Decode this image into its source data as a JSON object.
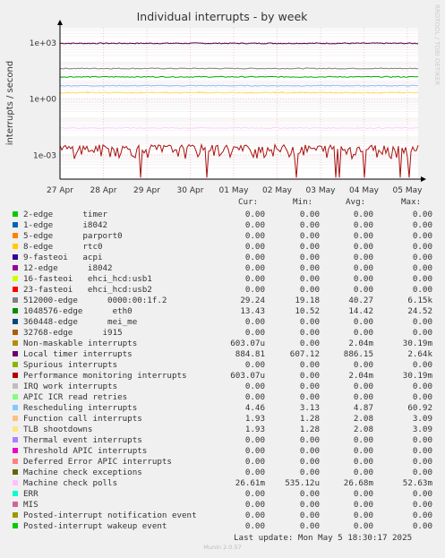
{
  "chart_data": {
    "type": "line",
    "title": "Individual interrupts - by week",
    "ylabel": "interrupts / second",
    "side_label": "RRDTOOL / TOBI OETIKER",
    "yscale": "log",
    "ylim": [
      5e-05,
      6000
    ],
    "yticks": [
      "1e+03",
      "1e+00",
      "1e-03"
    ],
    "ytick_values": [
      1000,
      1,
      0.001
    ],
    "xticks": [
      "27 Apr",
      "28 Apr",
      "29 Apr",
      "30 Apr",
      "01 May",
      "02 May",
      "03 May",
      "04 May",
      "05 May"
    ],
    "series": [
      {
        "name": "Local timer interrupts",
        "color": "#550055",
        "value": 886.15
      },
      {
        "name": "512000-edge 0000:00:1f.2",
        "color": "#7f7f7f",
        "value": 40.27
      },
      {
        "name": "1048576-edge eth0",
        "color": "#00aa00",
        "value": 14.42
      },
      {
        "name": "Rescheduling interrupts",
        "color": "#88bbff",
        "value": 4.87
      },
      {
        "name": "Function call interrupts",
        "color": "#ffcc66",
        "value": 2.08
      },
      {
        "name": "TLB shootdowns",
        "color": "#ffe680",
        "value": 2.08
      },
      {
        "name": "Machine check polls",
        "color": "#ffccff",
        "value": 0.0267
      },
      {
        "name": "Performance monitoring interrupts",
        "color": "#aa1111",
        "value": 0.00204
      }
    ]
  },
  "legend": {
    "headers": {
      "cur": "Cur:",
      "min": "Min:",
      "avg": "Avg:",
      "max": "Max:"
    },
    "rows": [
      {
        "label": "2-edge      timer",
        "color": "#00cc00",
        "cur": "0.00",
        "min": "0.00",
        "avg": "0.00",
        "max": "0.00"
      },
      {
        "label": "1-edge      i8042",
        "color": "#0066b3",
        "cur": "0.00",
        "min": "0.00",
        "avg": "0.00",
        "max": "0.00"
      },
      {
        "label": "5-edge      parport0",
        "color": "#ff8000",
        "cur": "0.00",
        "min": "0.00",
        "avg": "0.00",
        "max": "0.00"
      },
      {
        "label": "8-edge      rtc0",
        "color": "#ffcc00",
        "cur": "0.00",
        "min": "0.00",
        "avg": "0.00",
        "max": "0.00"
      },
      {
        "label": "9-fasteoi   acpi",
        "color": "#330099",
        "cur": "0.00",
        "min": "0.00",
        "avg": "0.00",
        "max": "0.00"
      },
      {
        "label": "12-edge      i8042",
        "color": "#990099",
        "cur": "0.00",
        "min": "0.00",
        "avg": "0.00",
        "max": "0.00"
      },
      {
        "label": "16-fasteoi   ehci_hcd:usb1",
        "color": "#ccff00",
        "cur": "0.00",
        "min": "0.00",
        "avg": "0.00",
        "max": "0.00"
      },
      {
        "label": "23-fasteoi   ehci_hcd:usb2",
        "color": "#ff0000",
        "cur": "0.00",
        "min": "0.00",
        "avg": "0.00",
        "max": "0.00"
      },
      {
        "label": "512000-edge      0000:00:1f.2",
        "color": "#808080",
        "cur": "29.24",
        "min": "19.18",
        "avg": "40.27",
        "max": "6.15k"
      },
      {
        "label": "1048576-edge      eth0",
        "color": "#008f00",
        "cur": "13.43",
        "min": "10.52",
        "avg": "14.42",
        "max": "24.52"
      },
      {
        "label": "360448-edge      mei_me",
        "color": "#00487d",
        "cur": "0.00",
        "min": "0.00",
        "avg": "0.00",
        "max": "0.00"
      },
      {
        "label": "32768-edge      i915",
        "color": "#b35a00",
        "cur": "0.00",
        "min": "0.00",
        "avg": "0.00",
        "max": "0.00"
      },
      {
        "label": "Non-maskable interrupts",
        "color": "#b38f00",
        "cur": "603.07u",
        "min": "0.00",
        "avg": "2.04m",
        "max": "30.19m"
      },
      {
        "label": "Local timer interrupts",
        "color": "#6b006b",
        "cur": "884.81",
        "min": "607.12",
        "avg": "886.15",
        "max": "2.64k"
      },
      {
        "label": "Spurious interrupts",
        "color": "#8fb300",
        "cur": "0.00",
        "min": "0.00",
        "avg": "0.00",
        "max": "0.00"
      },
      {
        "label": "Performance monitoring interrupts",
        "color": "#b30000",
        "cur": "603.07u",
        "min": "0.00",
        "avg": "2.04m",
        "max": "30.19m"
      },
      {
        "label": "IRQ work interrupts",
        "color": "#bebebe",
        "cur": "0.00",
        "min": "0.00",
        "avg": "0.00",
        "max": "0.00"
      },
      {
        "label": "APIC ICR read retries",
        "color": "#80ff80",
        "cur": "0.00",
        "min": "0.00",
        "avg": "0.00",
        "max": "0.00"
      },
      {
        "label": "Rescheduling interrupts",
        "color": "#80c9ff",
        "cur": "4.46",
        "min": "3.13",
        "avg": "4.87",
        "max": "60.92"
      },
      {
        "label": "Function call interrupts",
        "color": "#ffc080",
        "cur": "1.93",
        "min": "1.28",
        "avg": "2.08",
        "max": "3.09"
      },
      {
        "label": "TLB shootdowns",
        "color": "#ffe680",
        "cur": "1.93",
        "min": "1.28",
        "avg": "2.08",
        "max": "3.09"
      },
      {
        "label": "Thermal event interrupts",
        "color": "#aa80ff",
        "cur": "0.00",
        "min": "0.00",
        "avg": "0.00",
        "max": "0.00"
      },
      {
        "label": "Threshold APIC interrupts",
        "color": "#ee00cc",
        "cur": "0.00",
        "min": "0.00",
        "avg": "0.00",
        "max": "0.00"
      },
      {
        "label": "Deferred Error APIC interrupts",
        "color": "#ff8080",
        "cur": "0.00",
        "min": "0.00",
        "avg": "0.00",
        "max": "0.00"
      },
      {
        "label": "Machine check exceptions",
        "color": "#666600",
        "cur": "0.00",
        "min": "0.00",
        "avg": "0.00",
        "max": "0.00"
      },
      {
        "label": "Machine check polls",
        "color": "#ffbfff",
        "cur": "26.61m",
        "min": "535.12u",
        "avg": "26.68m",
        "max": "52.63m"
      },
      {
        "label": "ERR",
        "color": "#00ffcc",
        "cur": "0.00",
        "min": "0.00",
        "avg": "0.00",
        "max": "0.00"
      },
      {
        "label": "MIS",
        "color": "#cc6699",
        "cur": "0.00",
        "min": "0.00",
        "avg": "0.00",
        "max": "0.00"
      },
      {
        "label": "Posted-interrupt notification event",
        "color": "#999900",
        "cur": "0.00",
        "min": "0.00",
        "avg": "0.00",
        "max": "0.00"
      },
      {
        "label": "Posted-interrupt wakeup event",
        "color": "#00cc00",
        "cur": "0.00",
        "min": "0.00",
        "avg": "0.00",
        "max": "0.00"
      }
    ]
  },
  "footer": {
    "last_update": "Last update: Mon May  5 18:30:17 2025",
    "generator": "Munin 2.0.57"
  }
}
